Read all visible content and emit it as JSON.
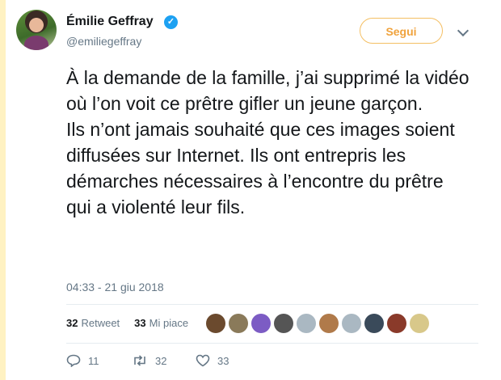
{
  "author": {
    "name": "Émilie Geffray",
    "handle": "@emiliegeffray",
    "verified": true
  },
  "follow_button": {
    "label": "Segui"
  },
  "tweet": {
    "text": "À la demande de la famille, j’ai supprimé la vidéo où l’on voit ce prêtre gifler un jeune garçon.\nIls n’ont jamais souhaité que ces images soient diffusées sur Internet. Ils ont entrepris les démarches nécessaires à l’encontre du prêtre qui a violenté leur fils.",
    "timestamp": "04:33 - 21 giu 2018"
  },
  "stats": {
    "retweet_count": "32",
    "retweet_label": "Retweet",
    "like_count": "33",
    "like_label": "Mi piace"
  },
  "liker_avatars": [
    {
      "color": "#6b4a2e"
    },
    {
      "color": "#8a7a5a"
    },
    {
      "color": "#7c5cc4"
    },
    {
      "color": "#555555"
    },
    {
      "color": "#aab8c2"
    },
    {
      "color": "#b07a4a"
    },
    {
      "color": "#aab8c2"
    },
    {
      "color": "#3a4a5a"
    },
    {
      "color": "#8a3a2a"
    },
    {
      "color": "#d8c88a"
    }
  ],
  "actions": {
    "reply_count": "11",
    "retweet_count": "32",
    "like_count": "33"
  },
  "colors": {
    "accent": "#f0a33d",
    "verified": "#1da1f2",
    "muted": "#657786",
    "left_rule": "#fff2c2"
  },
  "icons": [
    "verified-icon",
    "chevron-down-icon",
    "reply-icon",
    "retweet-icon",
    "heart-icon"
  ]
}
